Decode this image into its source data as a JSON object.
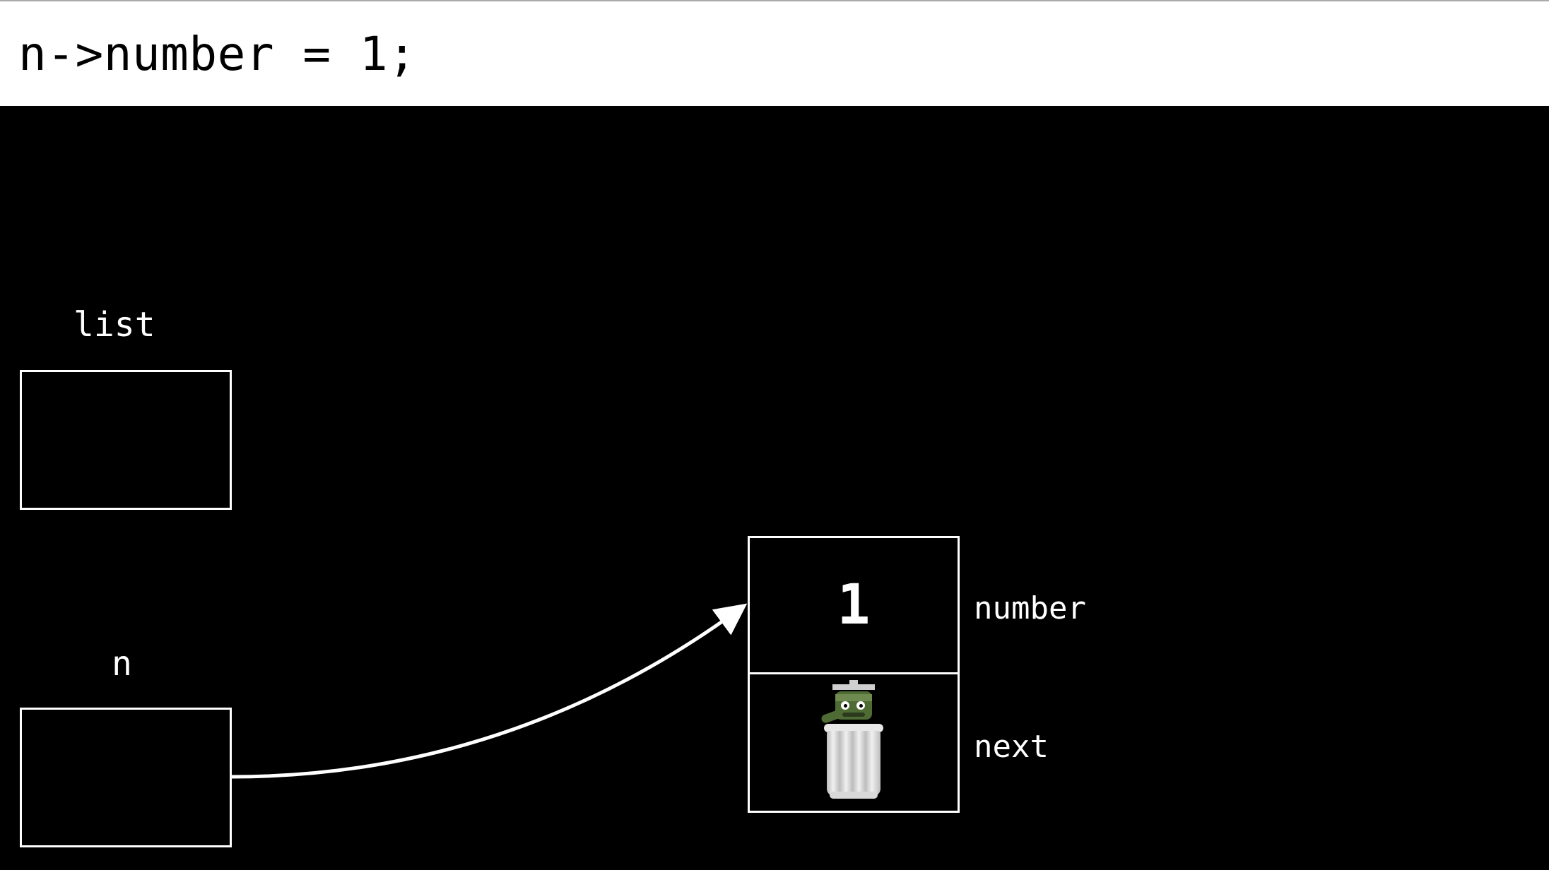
{
  "code_line": "n->number = 1;",
  "labels": {
    "list": "list",
    "n": "n",
    "number": "number",
    "next": "next"
  },
  "node": {
    "number_value": "1",
    "next_icon": "garbage-oscar-icon"
  }
}
